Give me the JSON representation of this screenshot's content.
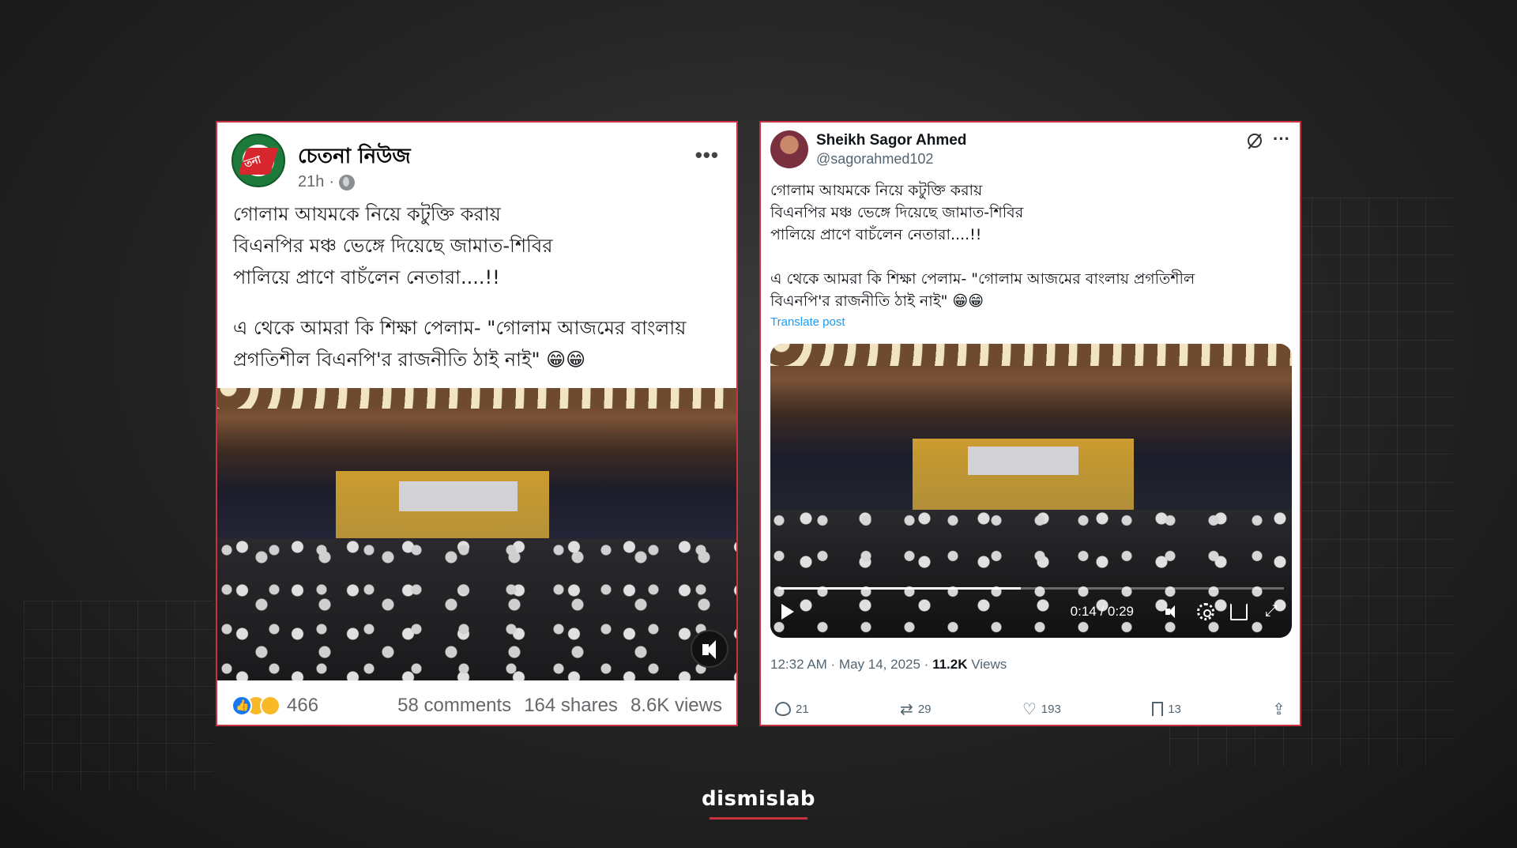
{
  "facebook_post": {
    "page_name": "চেতনা নিউজ",
    "time": "21h",
    "separator": "·",
    "avatar_text": "তনা",
    "lines": [
      "গোলাম আযমকে নিয়ে কটুক্তি করায়",
      "বিএনপির মঞ্চ ভেঙ্গে দিয়েছে জামাত-শিবির",
      "পালিয়ে প্রাণে বাচঁলেন নেতারা....!!"
    ],
    "lines2": [
      "এ থেকে আমরা কি শিক্ষা পেলাম- \"গোলাম আজমের বাংলায়",
      "প্রগতিশীল বিএনপি'র রাজনীতি ঠাই নাই\" 😁😁"
    ],
    "reaction_count": "466",
    "comments": "58 comments",
    "shares": "164 shares",
    "views": "8.6K views"
  },
  "x_post": {
    "display_name": "Sheikh Sagor Ahmed",
    "handle": "@sagorahmed102",
    "lines": [
      "গোলাম আযমকে নিয়ে কটুক্তি করায়",
      "বিএনপির মঞ্চ ভেঙ্গে দিয়েছে জামাত-শিবির",
      "পালিয়ে প্রাণে বাচঁলেন নেতারা....!!"
    ],
    "lines2": [
      "এ থেকে আমরা কি শিক্ষা পেলাম- \"গোলাম আজমের বাংলায় প্রগতিশীল",
      "বিএনপি'র রাজনীতি ঠাই নাই\" 😁😁"
    ],
    "translate_label": "Translate post",
    "video_time": "0:14 / 0:29",
    "video_progress": 0.48,
    "timestamp": "12:32 AM · May 14, 2025 ·",
    "views_count": "11.2K",
    "views_label": "Views",
    "replies": "21",
    "reposts": "29",
    "likes": "193",
    "bookmarks": "13"
  },
  "watermark": "dismislab",
  "colors": {
    "frame_red": "#c8323e",
    "x_blue": "#1d9bf0",
    "fb_blue": "#1877f2"
  }
}
